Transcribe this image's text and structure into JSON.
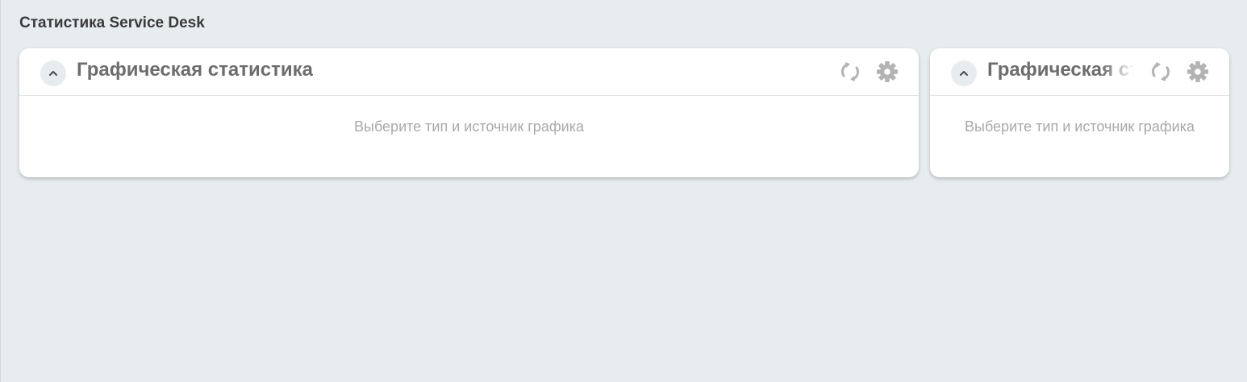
{
  "page": {
    "title": "Статистика Service Desk"
  },
  "widgets": [
    {
      "title": "Графическая статистика",
      "placeholder": "Выберите тип и источник графика"
    },
    {
      "title": "Графическая статистика",
      "placeholder": "Выберите тип и источник графика"
    }
  ],
  "icons": {
    "collapse": "chevron-up-icon",
    "refresh": "refresh-icon",
    "settings": "gear-icon"
  },
  "colors": {
    "page_background": "#e7ecee",
    "card_background": "#ffffff",
    "title_text": "#3a3a3a",
    "widget_title_text": "#6d6d6d",
    "icon_gray": "#b3b3b3",
    "placeholder_text": "#a9a9a9"
  }
}
